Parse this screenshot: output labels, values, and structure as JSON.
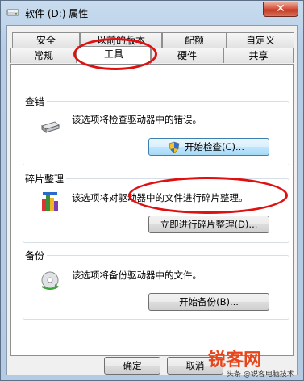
{
  "window": {
    "title": "软件 (D:) 属性",
    "close_glyph": "✕"
  },
  "tabs_row1": [
    "安全",
    "以前的版本",
    "配额",
    "自定义"
  ],
  "tabs_row2": [
    "常规",
    "工具",
    "硬件",
    "共享"
  ],
  "active_tab": "工具",
  "error_check": {
    "group_label": "查错",
    "description": "该选项将检查驱动器中的错误。",
    "button_label": "开始检查(C)..."
  },
  "defrag": {
    "group_label": "碎片整理",
    "description": "该选项将对驱动器中的文件进行碎片整理。",
    "button_label": "立即进行碎片整理(D)..."
  },
  "backup": {
    "group_label": "备份",
    "description": "该选项将备份驱动器中的文件。",
    "button_label": "开始备份(B)..."
  },
  "footer": {
    "ok_label": "确定",
    "cancel_label": "取消"
  },
  "watermark": {
    "main": "锐客网",
    "sub": "头条 @锐客电脑技术"
  },
  "colors": {
    "annotation_ring": "#e01010",
    "watermark": "#e8451a"
  }
}
